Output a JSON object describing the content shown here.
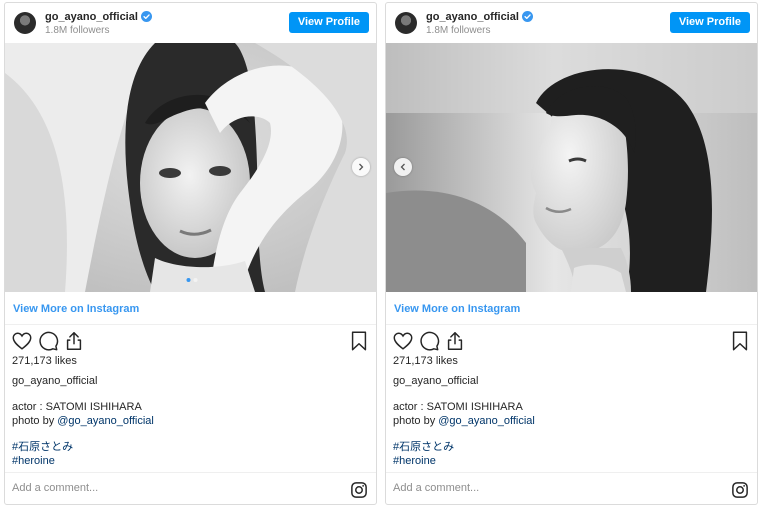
{
  "posts": [
    {
      "username": "go_ayano_official",
      "followers": "1.8M followers",
      "view_profile": "View Profile",
      "view_more": "View More on Instagram",
      "likes": "271,173 likes",
      "owner": "go_ayano_official",
      "caption_line1": "actor : SATOMI ISHIHARA",
      "caption_photo_by": "photo by ",
      "caption_mention": "@go_ayano_official",
      "hashtags": [
        "#石原さとみ",
        "#heroine"
      ],
      "comment_placeholder": "Add a comment...",
      "carousel_position": 1,
      "carousel_total": 2,
      "photo_icon": "portrait-photo-face-framed-by-arms"
    },
    {
      "username": "go_ayano_official",
      "followers": "1.8M followers",
      "view_profile": "View Profile",
      "view_more": "View More on Instagram",
      "likes": "271,173 likes",
      "owner": "go_ayano_official",
      "caption_line1": "actor : SATOMI ISHIHARA",
      "caption_photo_by": "photo by ",
      "caption_mention": "@go_ayano_official",
      "hashtags": [
        "#石原さとみ",
        "#heroine"
      ],
      "comment_placeholder": "Add a comment...",
      "photo_icon": "portrait-photo-side-profile"
    }
  ],
  "colors": {
    "accent": "#0095f6",
    "link": "#3897f0",
    "hashtag": "#003569",
    "border": "#dbdbdb",
    "muted": "#8e8e8e"
  },
  "icons": [
    "verified-badge-icon",
    "heart-icon",
    "comment-icon",
    "share-icon",
    "bookmark-icon",
    "instagram-logo-icon",
    "chevron-right-icon",
    "chevron-left-icon"
  ]
}
